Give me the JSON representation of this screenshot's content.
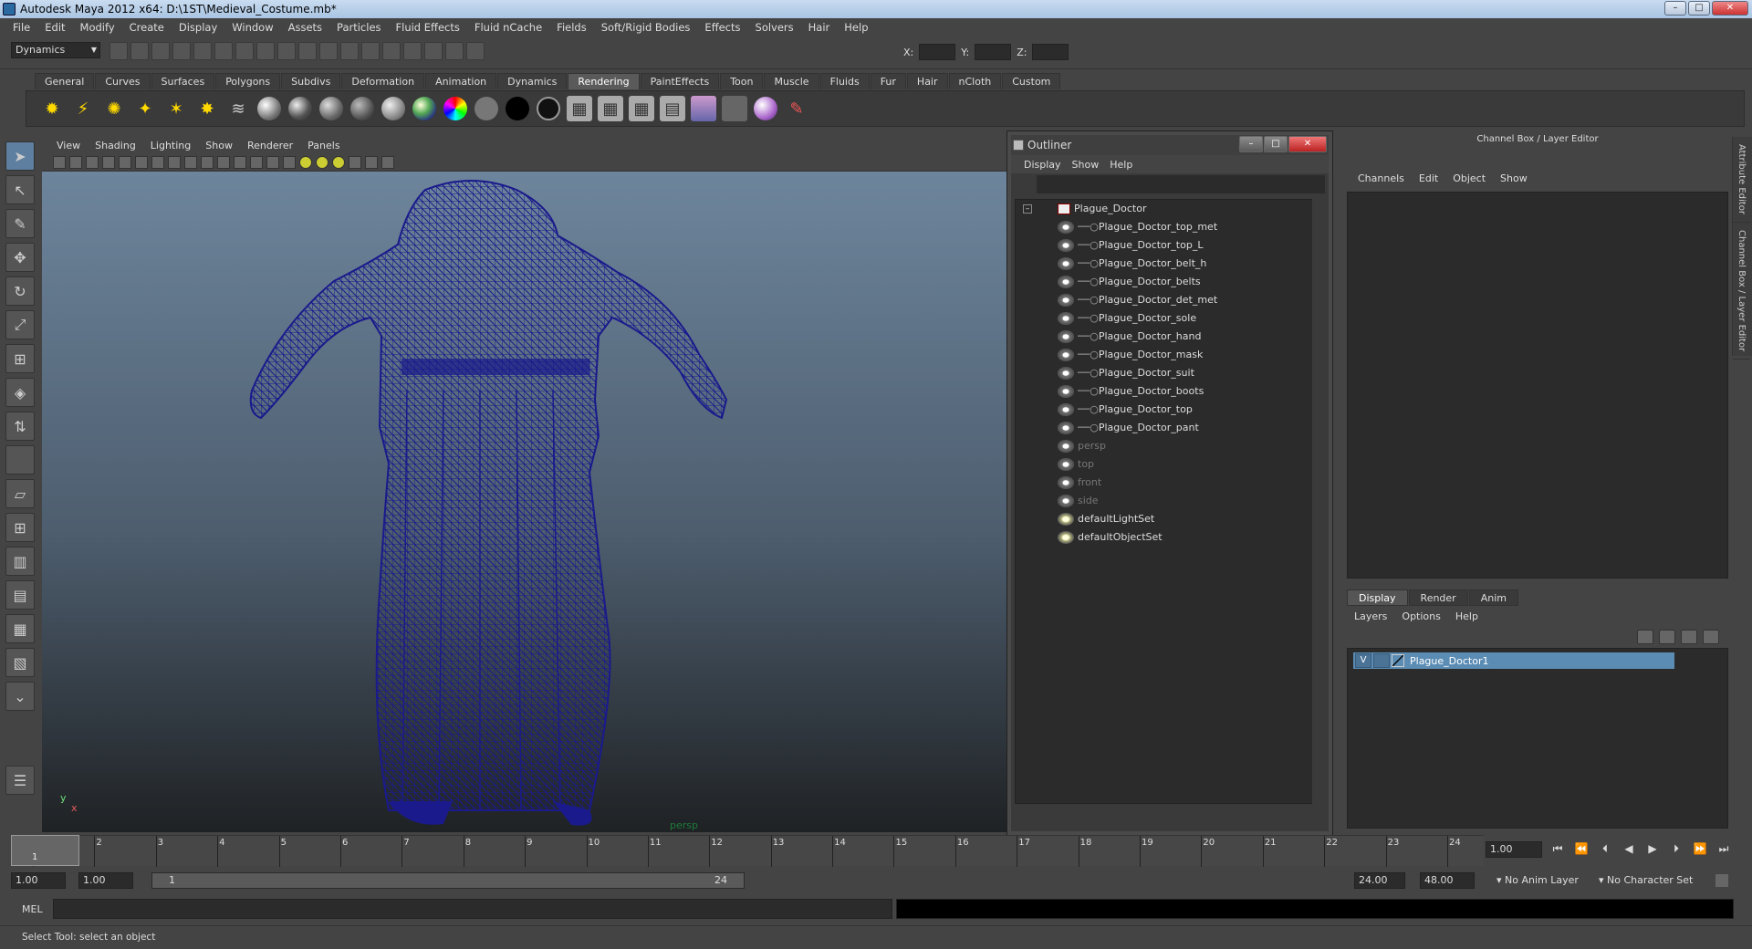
{
  "window": {
    "title": "Autodesk Maya 2012 x64: D:\\1ST\\Medieval_Costume.mb*"
  },
  "menubar": [
    "File",
    "Edit",
    "Modify",
    "Create",
    "Display",
    "Window",
    "Assets",
    "Particles",
    "Fluid Effects",
    "Fluid nCache",
    "Fields",
    "Soft/Rigid Bodies",
    "Effects",
    "Solvers",
    "Hair",
    "Help"
  ],
  "toolbar": {
    "mode": "Dynamics",
    "x_label": "X:",
    "y_label": "Y:",
    "z_label": "Z:"
  },
  "shelf_tabs": [
    "General",
    "Curves",
    "Surfaces",
    "Polygons",
    "Subdivs",
    "Deformation",
    "Animation",
    "Dynamics",
    "Rendering",
    "PaintEffects",
    "Toon",
    "Muscle",
    "Fluids",
    "Fur",
    "Hair",
    "nCloth",
    "Custom"
  ],
  "shelf_active": "Rendering",
  "panel_menu": [
    "View",
    "Shading",
    "Lighting",
    "Show",
    "Renderer",
    "Panels"
  ],
  "viewport": {
    "camera_label": "persp",
    "axis_y": "y",
    "axis_x": "x",
    "mesh_color": "#1a1a8c"
  },
  "outliner": {
    "title": "Outliner",
    "menu": [
      "Display",
      "Show",
      "Help"
    ],
    "root": "Plague_Doctor",
    "children": [
      "Plague_Doctor_top_met",
      "Plague_Doctor_top_L",
      "Plague_Doctor_belt_h",
      "Plague_Doctor_belts",
      "Plague_Doctor_det_met",
      "Plague_Doctor_sole",
      "Plague_Doctor_hand",
      "Plague_Doctor_mask",
      "Plague_Doctor_suit",
      "Plague_Doctor_boots",
      "Plague_Doctor_top",
      "Plague_Doctor_pant"
    ],
    "cameras": [
      "persp",
      "top",
      "front",
      "side"
    ],
    "sets": [
      "defaultLightSet",
      "defaultObjectSet"
    ]
  },
  "channel_box": {
    "header": "Channel Box / Layer Editor",
    "menu": [
      "Channels",
      "Edit",
      "Object",
      "Show"
    ]
  },
  "layer_editor": {
    "tabs": [
      "Display",
      "Render",
      "Anim"
    ],
    "active_tab": "Display",
    "menu": [
      "Layers",
      "Options",
      "Help"
    ],
    "layer_name": "Plague_Doctor1",
    "visibility": "V"
  },
  "side_tabs": [
    "Attribute Editor",
    "Channel Box / Layer Editor"
  ],
  "timeline": {
    "ticks": [
      "1",
      "2",
      "3",
      "4",
      "5",
      "6",
      "7",
      "8",
      "9",
      "10",
      "11",
      "12",
      "13",
      "14",
      "15",
      "16",
      "17",
      "18",
      "19",
      "20",
      "21",
      "22",
      "23",
      "24"
    ],
    "current_frame": "1",
    "current_value": "1.00"
  },
  "range": {
    "start_time": "1.00",
    "start_playback": "1.00",
    "bar_start": "1",
    "bar_end": "24",
    "end_playback": "24.00",
    "end_time": "48.00",
    "anim_layer": "No Anim Layer",
    "char_set": "No Character Set"
  },
  "command": {
    "label": "MEL"
  },
  "help_line": "Select Tool: select an object"
}
